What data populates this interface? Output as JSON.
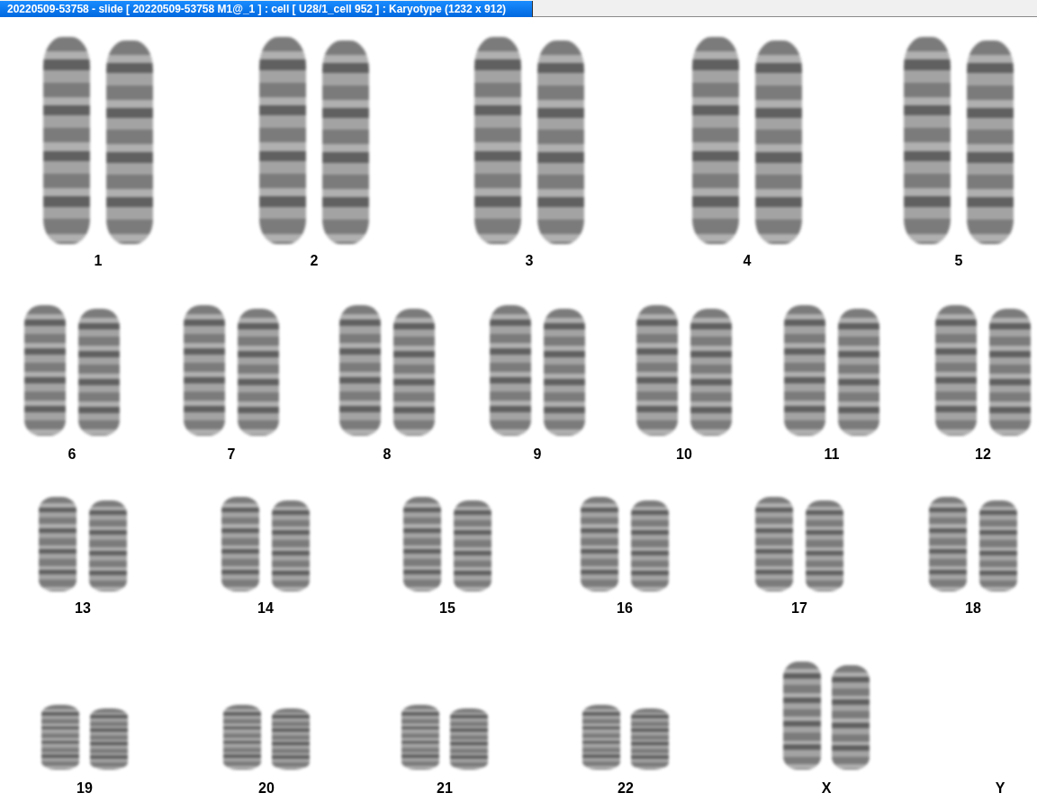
{
  "window": {
    "title": "20220509-53758 - slide [ 20220509-53758 M1@_1 ] : cell [ U28/1_cell 952 ] : Karyotype  (1232 x 912)"
  },
  "karyotype": {
    "rows": [
      {
        "items": [
          {
            "label": "1",
            "kind": "pair"
          },
          {
            "label": "2",
            "kind": "pair"
          },
          {
            "label": "3",
            "kind": "pair"
          },
          {
            "label": "4",
            "kind": "pair"
          },
          {
            "label": "5",
            "kind": "pair"
          }
        ]
      },
      {
        "items": [
          {
            "label": "6",
            "kind": "pair"
          },
          {
            "label": "7",
            "kind": "pair"
          },
          {
            "label": "8",
            "kind": "pair"
          },
          {
            "label": "9",
            "kind": "pair"
          },
          {
            "label": "10",
            "kind": "pair"
          },
          {
            "label": "11",
            "kind": "pair"
          },
          {
            "label": "12",
            "kind": "pair"
          }
        ]
      },
      {
        "items": [
          {
            "label": "13",
            "kind": "pair"
          },
          {
            "label": "14",
            "kind": "pair"
          },
          {
            "label": "15",
            "kind": "pair"
          },
          {
            "label": "16",
            "kind": "pair"
          },
          {
            "label": "17",
            "kind": "pair"
          },
          {
            "label": "18",
            "kind": "pair"
          }
        ]
      },
      {
        "items": [
          {
            "label": "19",
            "kind": "pair"
          },
          {
            "label": "20",
            "kind": "pair"
          },
          {
            "label": "21",
            "kind": "pair"
          },
          {
            "label": "22",
            "kind": "pair"
          },
          {
            "label": "X",
            "kind": "pair"
          },
          {
            "label": "Y",
            "kind": "empty"
          }
        ]
      }
    ]
  }
}
